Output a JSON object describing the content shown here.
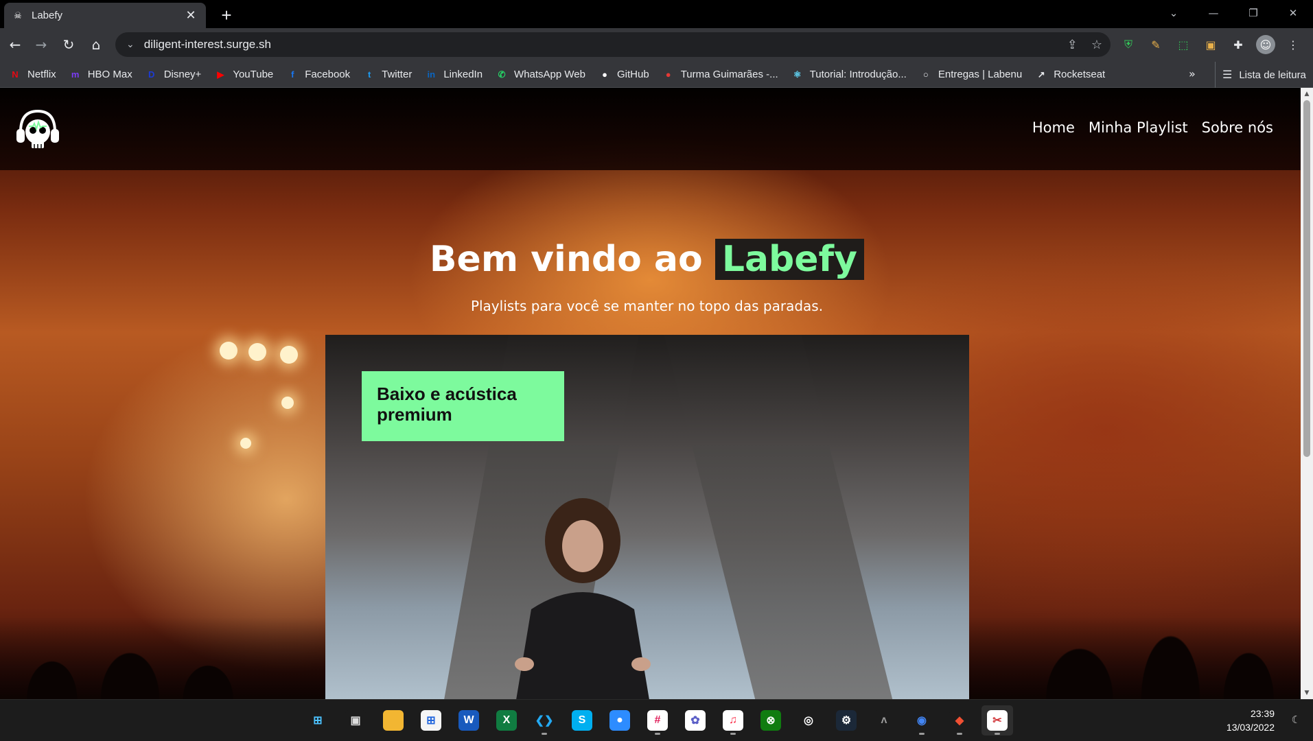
{
  "browser": {
    "tab_title": "Labefy",
    "url": "diligent-interest.surge.sh",
    "bookmarks": [
      {
        "label": "Netflix",
        "icon": "netflix-icon",
        "color": "#e50914",
        "glyph": "N"
      },
      {
        "label": "HBO Max",
        "icon": "hbomax-icon",
        "color": "#7b3cf5",
        "glyph": "m"
      },
      {
        "label": "Disney+",
        "icon": "disney-icon",
        "color": "#1c3bd6",
        "glyph": "D"
      },
      {
        "label": "YouTube",
        "icon": "youtube-icon",
        "color": "#ff0000",
        "glyph": "▶"
      },
      {
        "label": "Facebook",
        "icon": "facebook-icon",
        "color": "#1877f2",
        "glyph": "f"
      },
      {
        "label": "Twitter",
        "icon": "twitter-icon",
        "color": "#1d9bf0",
        "glyph": "t"
      },
      {
        "label": "LinkedIn",
        "icon": "linkedin-icon",
        "color": "#0a66c2",
        "glyph": "in"
      },
      {
        "label": "WhatsApp Web",
        "icon": "whatsapp-icon",
        "color": "#25d366",
        "glyph": "✆"
      },
      {
        "label": "GitHub",
        "icon": "github-icon",
        "color": "#ffffff",
        "glyph": "●"
      },
      {
        "label": "Turma Guimarães -...",
        "icon": "apple-icon",
        "color": "#e53935",
        "glyph": "●"
      },
      {
        "label": "Tutorial: Introdução...",
        "icon": "react-icon",
        "color": "#61dafb",
        "glyph": "⚛"
      },
      {
        "label": "Entregas | Labenu",
        "icon": "labenu-icon",
        "color": "#000000",
        "glyph": "○"
      },
      {
        "label": "Rocketseat",
        "icon": "rocketseat-icon",
        "color": "#000000",
        "glyph": "↗"
      }
    ],
    "more_label": "»",
    "reading_list_label": "Lista de leitura"
  },
  "site": {
    "nav": [
      "Home",
      "Minha Playlist",
      "Sobre nós"
    ],
    "hero_title_prefix": "Bem vindo ao",
    "hero_title_brand": "Labefy",
    "hero_subtitle": "Playlists para você se manter no topo das paradas.",
    "promo_text": "Baixo e acústica premium",
    "accent_color": "#7dfa9d"
  },
  "taskbar": {
    "time": "23:39",
    "date": "13/03/2022",
    "apps": [
      {
        "name": "start-icon",
        "glyph": "⊞",
        "bg": "#1c1c1c",
        "fg": "#4cc2ff",
        "dot": false
      },
      {
        "name": "task-view-icon",
        "glyph": "▣",
        "bg": "#1c1c1c",
        "fg": "#dddddd",
        "dot": false
      },
      {
        "name": "file-explorer-icon",
        "glyph": "▬",
        "bg": "#f2b632",
        "fg": "#f2b632",
        "dot": false
      },
      {
        "name": "microsoft-store-icon",
        "glyph": "⊞",
        "bg": "#f5f5f5",
        "fg": "#2266dd",
        "dot": false
      },
      {
        "name": "word-icon",
        "glyph": "W",
        "bg": "#185abd",
        "fg": "#ffffff",
        "dot": false
      },
      {
        "name": "excel-icon",
        "glyph": "X",
        "bg": "#107c41",
        "fg": "#ffffff",
        "dot": false
      },
      {
        "name": "vscode-icon",
        "glyph": "❮❯",
        "bg": "#1c1c1c",
        "fg": "#23a9f2",
        "dot": true
      },
      {
        "name": "skype-icon",
        "glyph": "S",
        "bg": "#00aff0",
        "fg": "#ffffff",
        "dot": false
      },
      {
        "name": "zoom-icon",
        "glyph": "●",
        "bg": "#2d8cff",
        "fg": "#ffffff",
        "dot": false
      },
      {
        "name": "slack-icon",
        "glyph": "#",
        "bg": "#ffffff",
        "fg": "#e01e5a",
        "dot": true
      },
      {
        "name": "settings-flower-icon",
        "glyph": "✿",
        "bg": "#ffffff",
        "fg": "#5b5fc7",
        "dot": false
      },
      {
        "name": "itunes-icon",
        "glyph": "♫",
        "bg": "#ffffff",
        "fg": "#fa2d48",
        "dot": true
      },
      {
        "name": "xbox-icon",
        "glyph": "⊗",
        "bg": "#107c10",
        "fg": "#ffffff",
        "dot": false
      },
      {
        "name": "ubisoft-icon",
        "glyph": "◎",
        "bg": "#1c1c1c",
        "fg": "#ffffff",
        "dot": false
      },
      {
        "name": "steam-icon",
        "glyph": "⚙",
        "bg": "#1b2838",
        "fg": "#ffffff",
        "dot": false
      },
      {
        "name": "predator-icon",
        "glyph": "ʌ",
        "bg": "#1c1c1c",
        "fg": "#999999",
        "dot": false
      },
      {
        "name": "chrome-icon",
        "glyph": "◉",
        "bg": "#1c1c1c",
        "fg": "#4285f4",
        "dot": true
      },
      {
        "name": "git-icon",
        "glyph": "◆",
        "bg": "#1c1c1c",
        "fg": "#f05033",
        "dot": true
      },
      {
        "name": "snipping-tool-icon",
        "glyph": "✂",
        "bg": "#ffffff",
        "fg": "#d13438",
        "dot": true
      }
    ]
  }
}
